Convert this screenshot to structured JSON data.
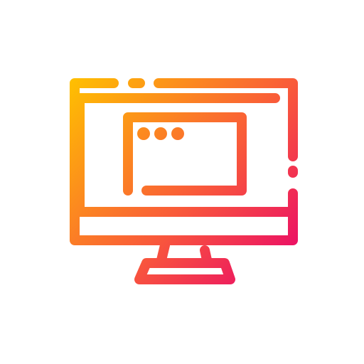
{
  "icon": {
    "name": "monitor-window-icon",
    "gradient": {
      "start_color": "#FFC000",
      "mid_color": "#F95A3A",
      "end_color": "#E8006E"
    },
    "window_dots": 3
  }
}
